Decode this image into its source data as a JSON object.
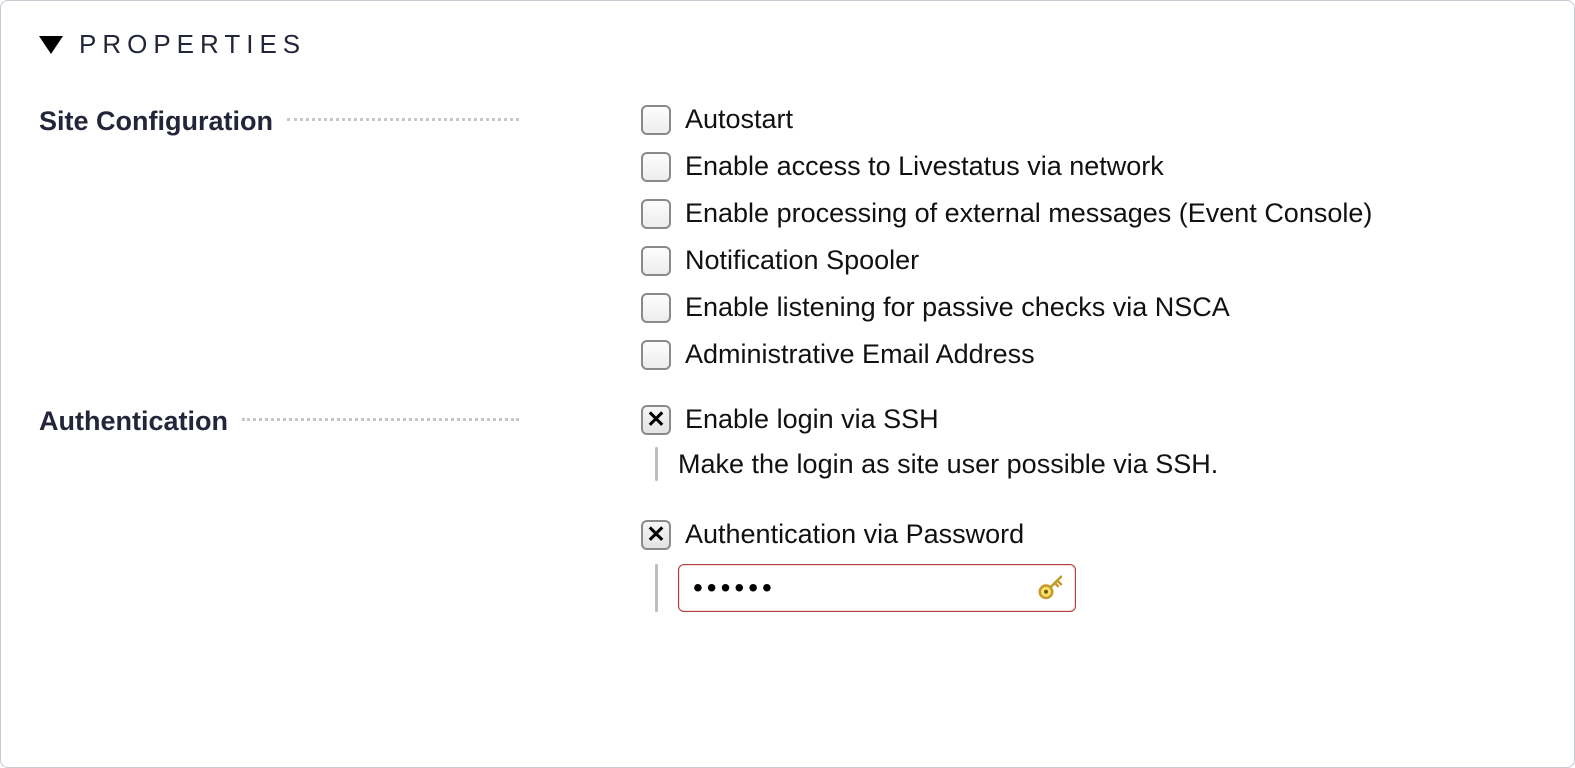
{
  "header": {
    "title": "PROPERTIES"
  },
  "groups": {
    "site_config": {
      "label": "Site Configuration",
      "options": [
        {
          "key": "autostart",
          "label": "Autostart",
          "checked": false
        },
        {
          "key": "livestatus",
          "label": "Enable access to Livestatus via network",
          "checked": false
        },
        {
          "key": "event_console",
          "label": "Enable processing of external messages (Event Console)",
          "checked": false
        },
        {
          "key": "notif_spooler",
          "label": "Notification Spooler",
          "checked": false
        },
        {
          "key": "nsca",
          "label": "Enable listening for passive checks via NSCA",
          "checked": false
        },
        {
          "key": "admin_email",
          "label": "Administrative Email Address",
          "checked": false
        }
      ]
    },
    "authentication": {
      "label": "Authentication",
      "ssh": {
        "label": "Enable login via SSH",
        "checked": true,
        "help": "Make the login as site user possible via SSH."
      },
      "password": {
        "label": "Authentication via Password",
        "checked": true,
        "value": "••••••"
      }
    }
  }
}
